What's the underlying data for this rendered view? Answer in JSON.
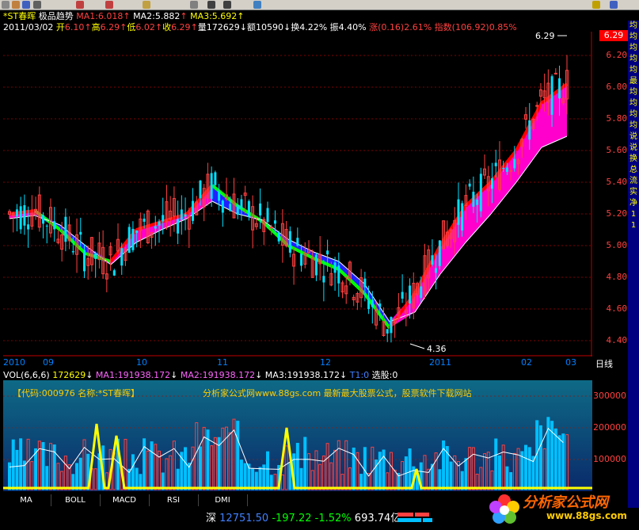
{
  "toolbar": {
    "icons": [
      "stock-icon",
      "pen-icon",
      "arrow-icon",
      "lines-icon",
      "home-icon",
      "alarm-icon",
      "bell-icon",
      "zoom-icon",
      "pin-icon",
      "pin-icon-2",
      "trend-icon"
    ],
    "right_icons": [
      "lock-icon",
      "help-icon"
    ]
  },
  "header": {
    "stock_name": "*ST春晖",
    "indicator": "极品趋势",
    "ma1": "MA1:6.018",
    "ma2": "MA2:5.882",
    "ma3": "MA3:5.692",
    "date": "2011/03/02",
    "open_label": "开",
    "open": "6.10",
    "high_label": "高",
    "high": "6.29",
    "low_label": "低",
    "low": "6.02",
    "close_label": "收",
    "close": "6.29",
    "vol_label": "量",
    "vol": "172629",
    "amount_label": "额",
    "amount": "10590",
    "turnover_label": "换",
    "turnover": "4.22%",
    "amp_label": "振",
    "amp": "4.40%",
    "change_label": "涨",
    "change": "(0.16)2.61%",
    "index_label": "指数",
    "index": "(106.92)0.85%"
  },
  "price_axis": [
    "6.20",
    "6.00",
    "5.80",
    "5.60",
    "5.40",
    "5.20",
    "5.00",
    "4.80",
    "4.60",
    "4.40"
  ],
  "current_price": "6.29",
  "peak_label": "6.29",
  "low_label": "4.36",
  "date_axis": [
    "2010",
    "09",
    "10",
    "11",
    "12",
    "2011",
    "02",
    "03"
  ],
  "period_label": "日线",
  "volume": {
    "title": "VOL(6,6,6)",
    "vol": "172629",
    "ma1": "MA1:191938.172",
    "ma2": "MA2:191938.172",
    "ma3": "MA3:191938.172",
    "t1": "T1:0",
    "select": "选股:0",
    "banner_code": "【代码:000976 名称:*ST春晖】",
    "banner_site": "分析家公式网www.88gs.com 最新最大股票公式，股票软件下载网站",
    "axis": [
      "300000",
      "200000",
      "100000"
    ]
  },
  "tabs": [
    "MA",
    "BOLL",
    "MACD",
    "RSI",
    "DMI"
  ],
  "right_panel": [
    "均",
    "均",
    "均",
    "均",
    "均",
    "最",
    "均",
    "均",
    "均",
    "均",
    "说",
    "说",
    "换",
    "总",
    "流",
    "实",
    "净",
    "1",
    "1"
  ],
  "status": {
    "market": "深",
    "index": "12751.50",
    "change": "-197.22",
    "pct": "-1.52%",
    "amount": "693.74亿"
  },
  "logo": {
    "name": "分析家公式网",
    "url": "www.88gs.com"
  },
  "chart_data": {
    "type": "candlestick",
    "title": "*ST春晖 极品趋势",
    "ylim": [
      4.3,
      6.35
    ],
    "x_labels": [
      "2010",
      "09",
      "10",
      "11",
      "12",
      "2011",
      "02",
      "03"
    ],
    "series": [
      {
        "name": "MA1",
        "values": [
          5.2,
          5.22,
          5.1,
          4.95,
          4.9,
          5.1,
          5.15,
          5.2,
          5.38,
          5.25,
          5.15,
          5.0,
          4.92,
          4.85,
          4.7,
          4.48,
          4.7,
          5.0,
          5.25,
          5.4,
          5.6,
          5.9,
          6.02
        ]
      },
      {
        "name": "MA2",
        "values": [
          5.18,
          5.2,
          5.12,
          4.98,
          4.88,
          5.05,
          5.12,
          5.18,
          5.32,
          5.22,
          5.15,
          5.02,
          4.95,
          4.88,
          4.72,
          4.5,
          4.62,
          4.9,
          5.1,
          5.3,
          5.5,
          5.78,
          5.88
        ]
      },
      {
        "name": "MA3",
        "values": [
          5.17,
          5.19,
          5.13,
          5.0,
          4.88,
          5.02,
          5.1,
          5.17,
          5.28,
          5.2,
          5.16,
          5.04,
          4.96,
          4.9,
          4.76,
          4.52,
          4.58,
          4.82,
          5.02,
          5.2,
          5.4,
          5.62,
          5.69
        ]
      }
    ]
  }
}
